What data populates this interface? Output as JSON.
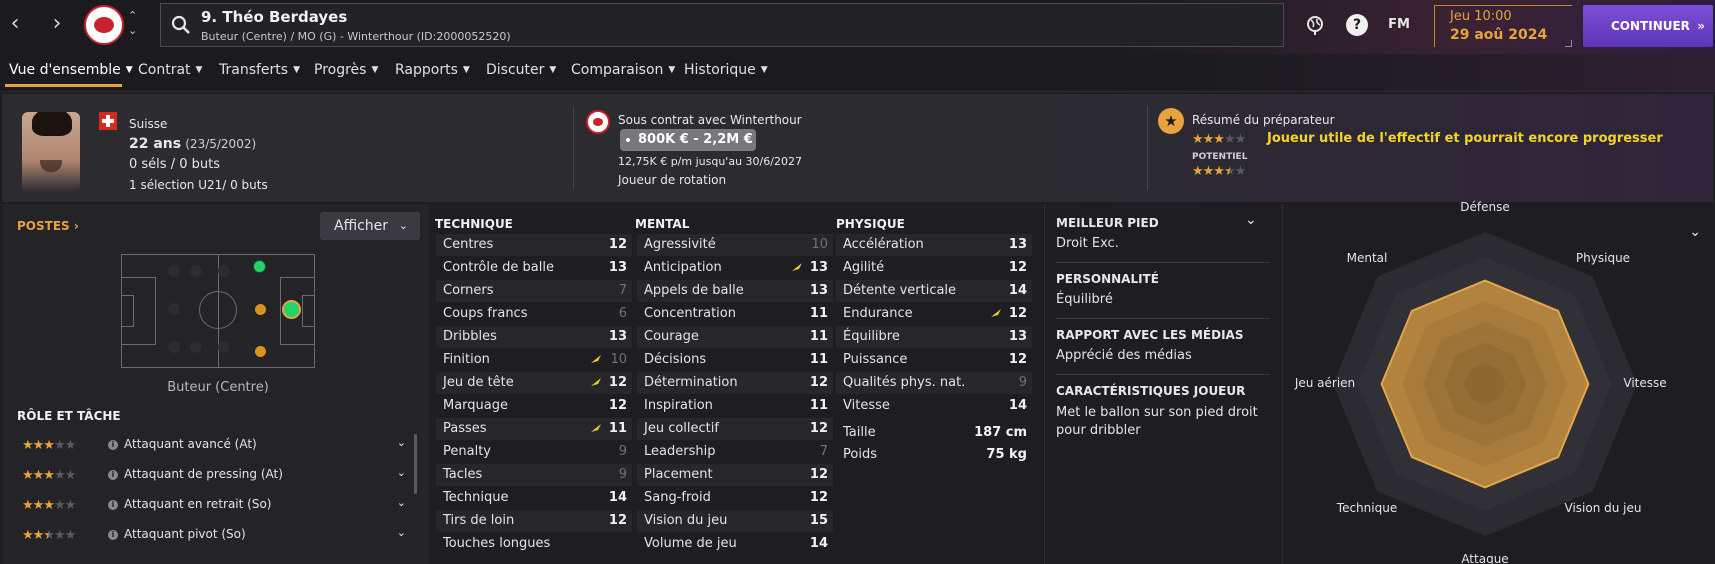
{
  "topbar": {
    "player_title": "9. Théo Berdayes",
    "player_subtitle": "Buteur (Centre) / MO (G) - Winterthour (ID:2000052520)",
    "fm_label": "FM",
    "help_label": "?",
    "day_time": "Jeu 10:00",
    "date": "29 aoû 2024",
    "continue_label": "CONTINUER",
    "continue_arrow": "»",
    "back_arrow": "‹",
    "forward_arrow": "›",
    "updown": "⌃⌄"
  },
  "tabs": [
    {
      "label": "Vue d'ensemble"
    },
    {
      "label": "Contrat"
    },
    {
      "label": "Transferts"
    },
    {
      "label": "Progrès"
    },
    {
      "label": "Rapports"
    },
    {
      "label": "Discuter"
    },
    {
      "label": "Comparaison"
    },
    {
      "label": "Historique"
    }
  ],
  "chevron": "⌄",
  "header": {
    "nationality": "Suisse",
    "age": "22 ans",
    "dob": "(23/5/2002)",
    "caps": "0 séls / 0 buts",
    "u21": "1 sélection U21/ 0 buts",
    "contract_label": "Sous contrat avec Winterthour",
    "value_range": "800K € - 2,2M €",
    "wage": "12,75K € p/m jusqu'au 30/6/2027",
    "squad_status": "Joueur de rotation",
    "coach_title": "Résumé du préparateur",
    "coach_summary": "Joueur utile de l'effectif et pourrait encore progresser",
    "potential_label": "POTENTIEL",
    "current_stars": 3,
    "potential_stars": 3.5
  },
  "positions": {
    "title": "POSTES",
    "title_arrow": "›",
    "afficher": "Afficher",
    "position_name": "Buteur (Centre)",
    "colors": {
      "natural": "#22d36a",
      "accomplished": "#d8931e"
    }
  },
  "roles": {
    "title": "RÔLE ET TÂCHE",
    "items": [
      {
        "stars": 3,
        "label": "Attaquant avancé (At)"
      },
      {
        "stars": 3,
        "label": "Attaquant de pressing (At)"
      },
      {
        "stars": 3,
        "label": "Attaquant en retrait (So)"
      },
      {
        "stars": 2.5,
        "label": "Attaquant pivot (So)"
      }
    ]
  },
  "attributes": {
    "technical": {
      "title": "TECHNIQUE",
      "rows": [
        {
          "name": "Centres",
          "value": "12"
        },
        {
          "name": "Contrôle de balle",
          "value": "13"
        },
        {
          "name": "Corners",
          "value": "7"
        },
        {
          "name": "Coups francs",
          "value": "6"
        },
        {
          "name": "Dribbles",
          "value": "13"
        },
        {
          "name": "Finition",
          "value": "10",
          "trend": true
        },
        {
          "name": "Jeu de tête",
          "value": "12",
          "trend": true
        },
        {
          "name": "Marquage",
          "value": "12"
        },
        {
          "name": "Passes",
          "value": "11",
          "trend": true
        },
        {
          "name": "Penalty",
          "value": "9"
        },
        {
          "name": "Tacles",
          "value": "9"
        },
        {
          "name": "Technique",
          "value": "14"
        },
        {
          "name": "Tirs de loin",
          "value": "12"
        },
        {
          "name": "Touches longues",
          "value": ""
        }
      ]
    },
    "mental": {
      "title": "MENTAL",
      "rows": [
        {
          "name": "Agressivité",
          "value": "10"
        },
        {
          "name": "Anticipation",
          "value": "13",
          "trend": true
        },
        {
          "name": "Appels de balle",
          "value": "13"
        },
        {
          "name": "Concentration",
          "value": "11"
        },
        {
          "name": "Courage",
          "value": "11"
        },
        {
          "name": "Décisions",
          "value": "11"
        },
        {
          "name": "Détermination",
          "value": "12"
        },
        {
          "name": "Inspiration",
          "value": "11"
        },
        {
          "name": "Jeu collectif",
          "value": "12"
        },
        {
          "name": "Leadership",
          "value": "7"
        },
        {
          "name": "Placement",
          "value": "12"
        },
        {
          "name": "Sang-froid",
          "value": "12"
        },
        {
          "name": "Vision du jeu",
          "value": "15"
        },
        {
          "name": "Volume de jeu",
          "value": "14"
        }
      ]
    },
    "physical": {
      "title": "PHYSIQUE",
      "rows": [
        {
          "name": "Accélération",
          "value": "13"
        },
        {
          "name": "Agilité",
          "value": "12"
        },
        {
          "name": "Détente verticale",
          "value": "14"
        },
        {
          "name": "Endurance",
          "value": "12",
          "trend": true
        },
        {
          "name": "Équilibre",
          "value": "13"
        },
        {
          "name": "Puissance",
          "value": "12"
        },
        {
          "name": "Qualités phys. nat.",
          "value": "9"
        },
        {
          "name": "Vitesse",
          "value": "14"
        }
      ],
      "extra": [
        {
          "name": "Taille",
          "value": "187 cm"
        },
        {
          "name": "Poids",
          "value": "75 kg"
        }
      ]
    }
  },
  "info": {
    "foot_title": "MEILLEUR PIED",
    "foot_value": "Droit Exc.",
    "personality_title": "PERSONNALITÉ",
    "personality_value": "Équilibré",
    "media_title": "RAPPORT AVEC LES MÉDIAS",
    "media_value": "Apprécié des médias",
    "traits_title": "CARACTÉRISTIQUES JOUEUR",
    "traits_value": "Met le ballon sur son pied droit pour dribbler"
  },
  "radar": {
    "axes": [
      "Défense",
      "Physique",
      "Vitesse",
      "Vision du jeu",
      "Attaque",
      "Technique",
      "Jeu aérien",
      "Mental"
    ],
    "values": [
      0.68,
      0.68,
      0.68,
      0.68,
      0.68,
      0.68,
      0.68,
      0.68
    ],
    "fill_color": "#c8913f"
  },
  "colors": {
    "accent": "#e8a23e",
    "continue": "#6b43c9",
    "trend": "#e6d41e",
    "highlight_text": "#f2d42a"
  }
}
